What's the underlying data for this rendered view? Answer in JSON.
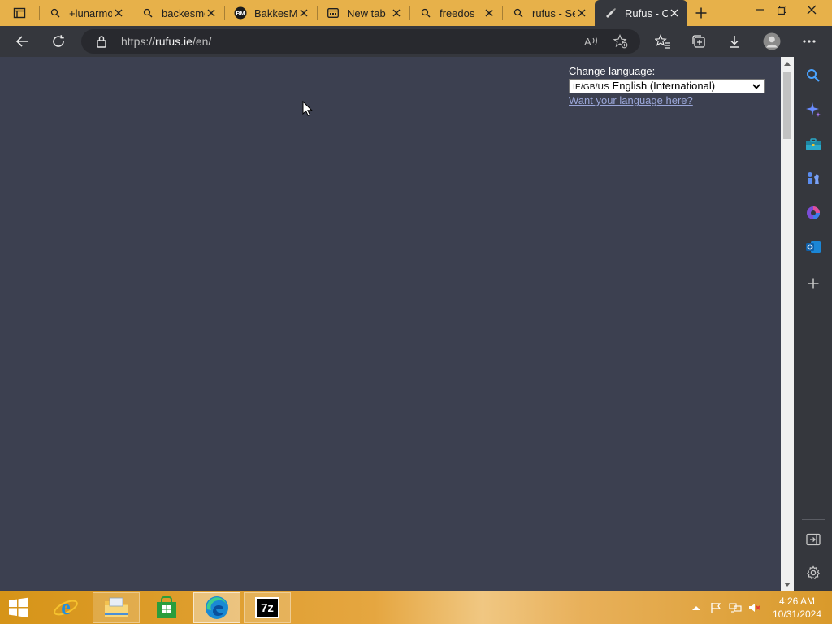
{
  "browser": {
    "tabs": [
      {
        "title": "+lunarmod",
        "icon": "search-icon",
        "active": false
      },
      {
        "title": "backesmod",
        "icon": "search-icon",
        "active": false
      },
      {
        "title": "BakkesMod",
        "icon": "bakkesmod-logo-icon",
        "active": false
      },
      {
        "title": "New tab",
        "icon": "newtab-icon",
        "active": false
      },
      {
        "title": "freedos",
        "icon": "search-icon",
        "active": false
      },
      {
        "title": "rufus - Search",
        "icon": "search-icon",
        "active": false
      },
      {
        "title": "Rufus - Create",
        "icon": "rufus-logo-icon",
        "active": true
      }
    ],
    "address": {
      "scheme": "https://",
      "domain": "rufus.ie",
      "path": "/en/"
    }
  },
  "page": {
    "language_label": "Change language:",
    "language_flag": "IE/GB/US",
    "language_selected": "English (International)",
    "language_link": "Want your language here?"
  },
  "taskbar": {
    "apps": [
      {
        "name": "Internet Explorer",
        "icon": "internet-explorer-icon"
      },
      {
        "name": "File Explorer",
        "icon": "file-explorer-icon"
      },
      {
        "name": "Store",
        "icon": "store-icon"
      },
      {
        "name": "Microsoft Edge",
        "icon": "edge-icon"
      },
      {
        "name": "7-Zip",
        "icon": "seven-zip-icon",
        "text": "7z"
      }
    ],
    "time": "4:26 AM",
    "date": "10/31/2024"
  },
  "colors": {
    "tabbar": "#e7b14a",
    "toolbar": "#35373d",
    "page_background": "#3c4050",
    "link": "#9aa6d8"
  }
}
